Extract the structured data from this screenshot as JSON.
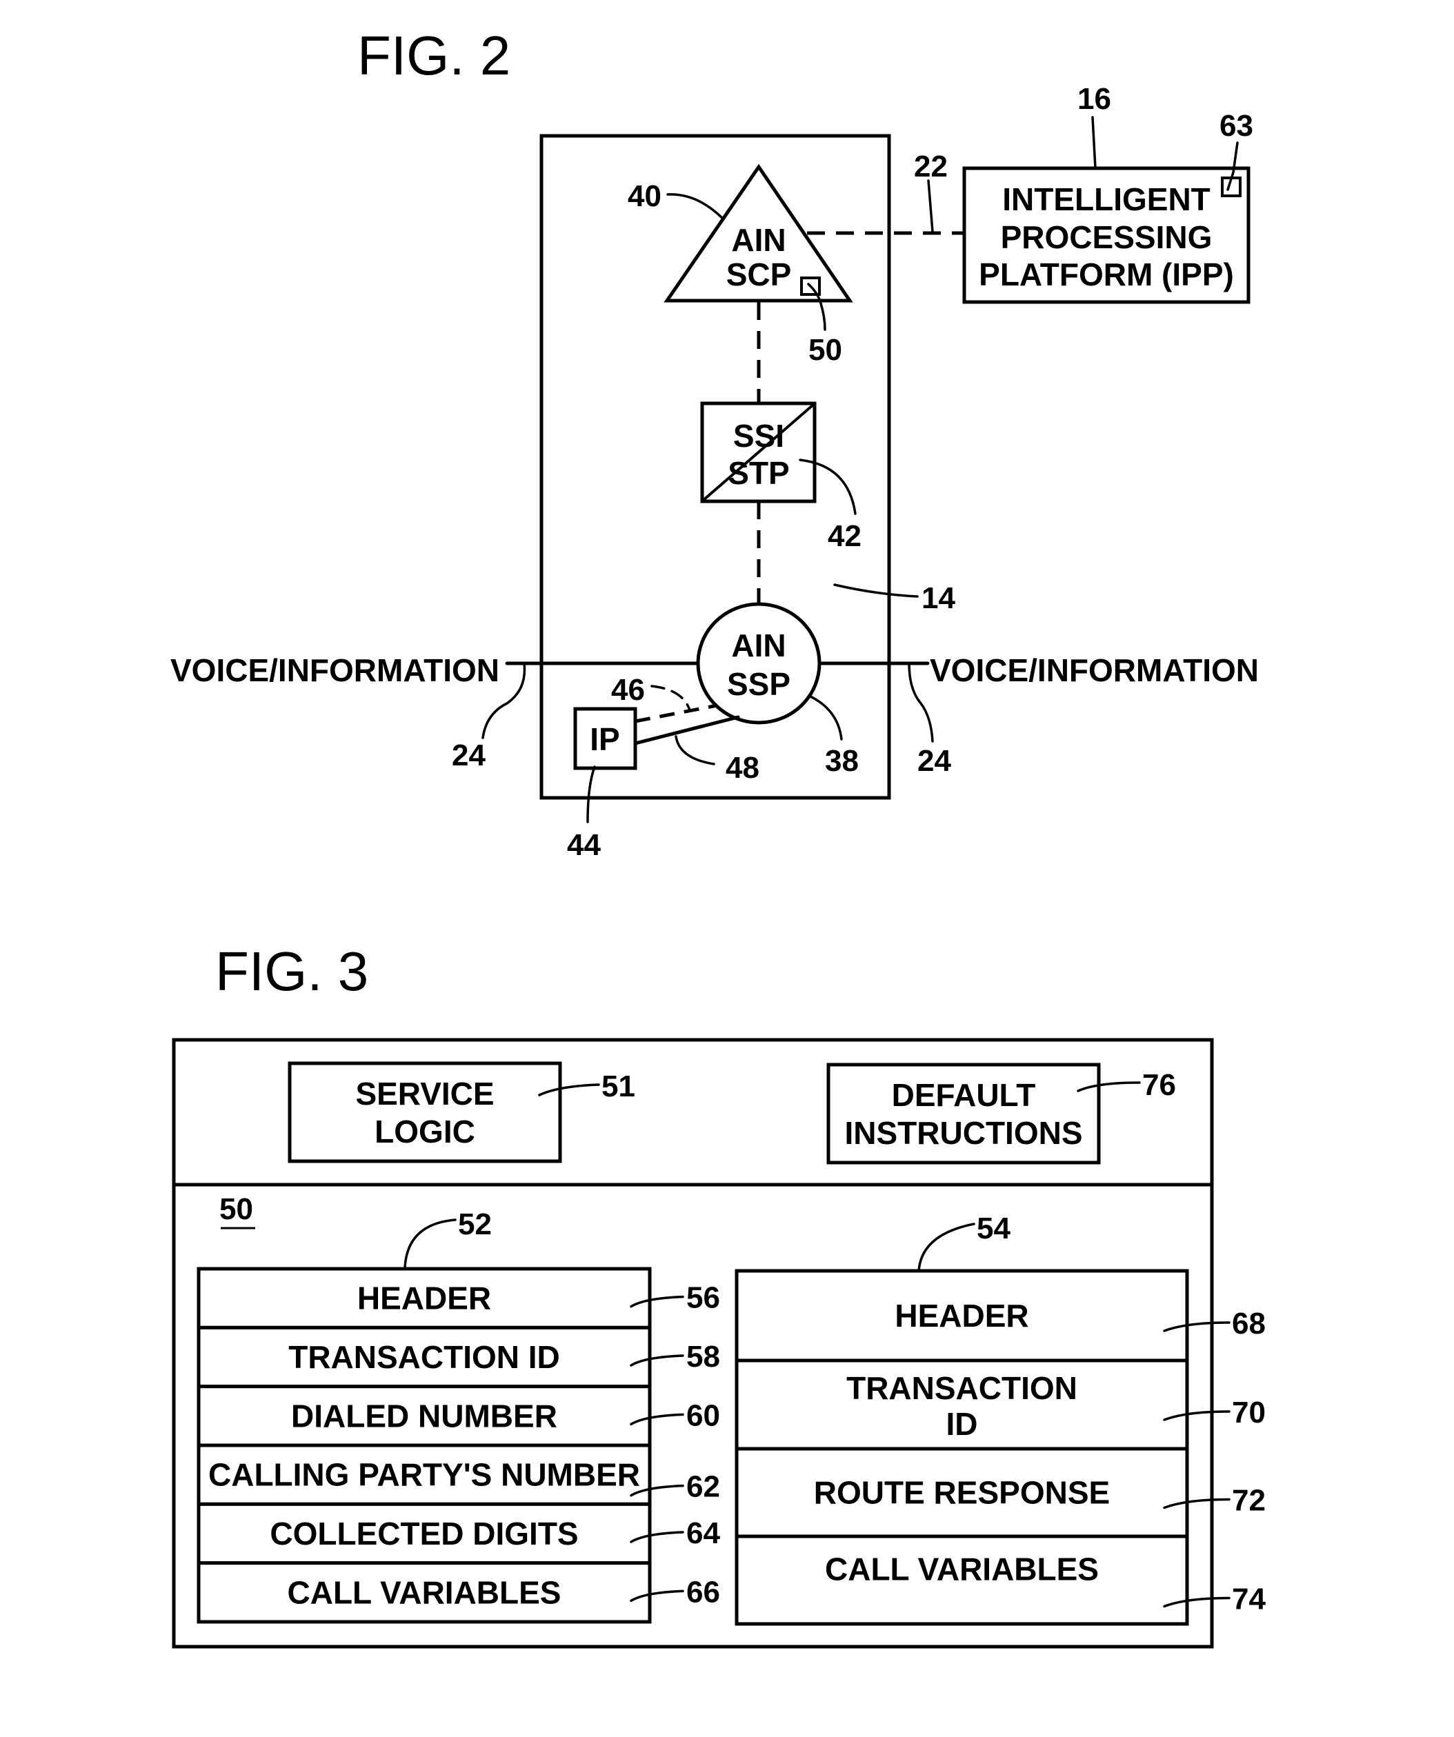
{
  "fig2": {
    "title": "FIG. 2",
    "network_ref": "14",
    "scp": {
      "line1": "AIN",
      "line2": "SCP",
      "ref": "40",
      "module_ref": "50"
    },
    "stp": {
      "line1": "SSI",
      "line2": "STP",
      "ref": "42"
    },
    "ssp": {
      "line1": "AIN",
      "line2": "SSP",
      "ref": "38"
    },
    "ip": {
      "label": "IP",
      "ref": "44",
      "link_ref_dashed": "46",
      "link_ref_solid": "48"
    },
    "ipp": {
      "line1": "INTELLIGENT",
      "line2": "PROCESSING",
      "line3": "PLATFORM (IPP)",
      "ref": "16",
      "module_ref": "63",
      "link_ref": "22"
    },
    "voice_left": {
      "label": "VOICE/INFORMATION",
      "ref": "24"
    },
    "voice_right": {
      "label": "VOICE/INFORMATION",
      "ref": "24"
    }
  },
  "fig3": {
    "title": "FIG. 3",
    "module_ref": "50",
    "service_logic": {
      "line1": "SERVICE",
      "line2": "LOGIC",
      "ref": "51"
    },
    "default_instructions": {
      "line1": "DEFAULT",
      "line2": "INSTRUCTIONS",
      "ref": "76"
    },
    "query_message": {
      "ref": "52",
      "fields": [
        {
          "label": "HEADER",
          "ref": "56"
        },
        {
          "label": "TRANSACTION ID",
          "ref": "58"
        },
        {
          "label": "DIALED NUMBER",
          "ref": "60"
        },
        {
          "label": "CALLING PARTY'S NUMBER",
          "ref": "62"
        },
        {
          "label": "COLLECTED DIGITS",
          "ref": "64"
        },
        {
          "label": "CALL VARIABLES",
          "ref": "66"
        }
      ]
    },
    "response_message": {
      "ref": "54",
      "fields": [
        {
          "line1": "HEADER",
          "line2": "",
          "ref": "68"
        },
        {
          "line1": "TRANSACTION",
          "line2": "ID",
          "ref": "70"
        },
        {
          "line1": "ROUTE RESPONSE",
          "line2": "",
          "ref": "72"
        },
        {
          "line1": "CALL VARIABLES",
          "line2": "",
          "ref": "74"
        }
      ]
    }
  }
}
